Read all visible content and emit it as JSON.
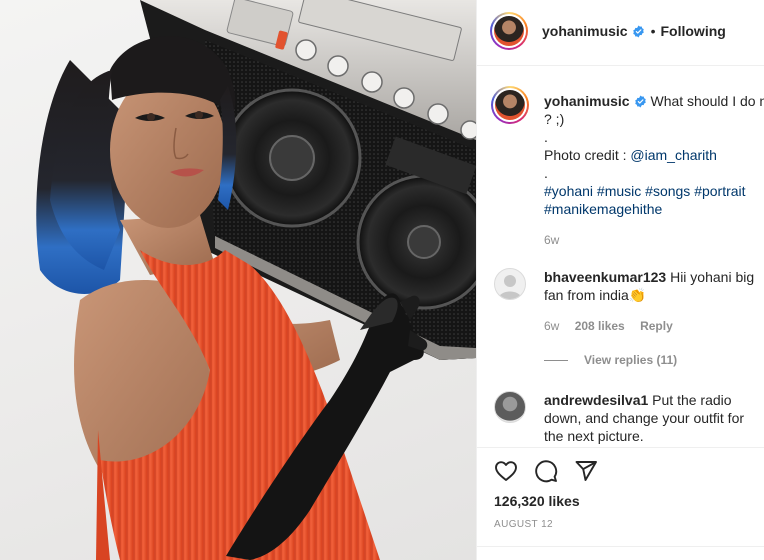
{
  "post": {
    "username": "yohanimusic",
    "separator": "•",
    "follow_status": "Following",
    "caption": {
      "text": "What should I do ne",
      "line2": "? ;)",
      "line3": ".",
      "credit_prefix": "Photo credit : ",
      "credit_mention": "@iam_charith",
      "line5": ".",
      "hashtags_line1": "#yohani #music #songs #portrait",
      "hashtags_line2": "#manikemagehithe",
      "time": "6w"
    },
    "comments": [
      {
        "username": "bhaveenkumar123",
        "text": "Hii yohani big",
        "text_line2": "fan from india👏",
        "time": "6w",
        "likes": "208 likes",
        "reply": "Reply",
        "view_replies": "View replies (11)"
      },
      {
        "username": "andrewdesilva1",
        "text": "Put the radio",
        "text_line2": "down, and change your outfit for",
        "text_line3": "the next picture."
      }
    ],
    "likes_count": "126,320 likes",
    "date": "AUGUST 12"
  },
  "colors": {
    "verified_badge": "#3897f0",
    "dress": "#e2532f",
    "hair_tips": "#2f6fc4",
    "link": "#00376b",
    "muted": "#8e8e8e"
  },
  "icons": {
    "like": "heart-outline-icon",
    "comment": "speech-bubble-icon",
    "share": "paper-plane-icon",
    "verified": "verified-badge-icon"
  }
}
